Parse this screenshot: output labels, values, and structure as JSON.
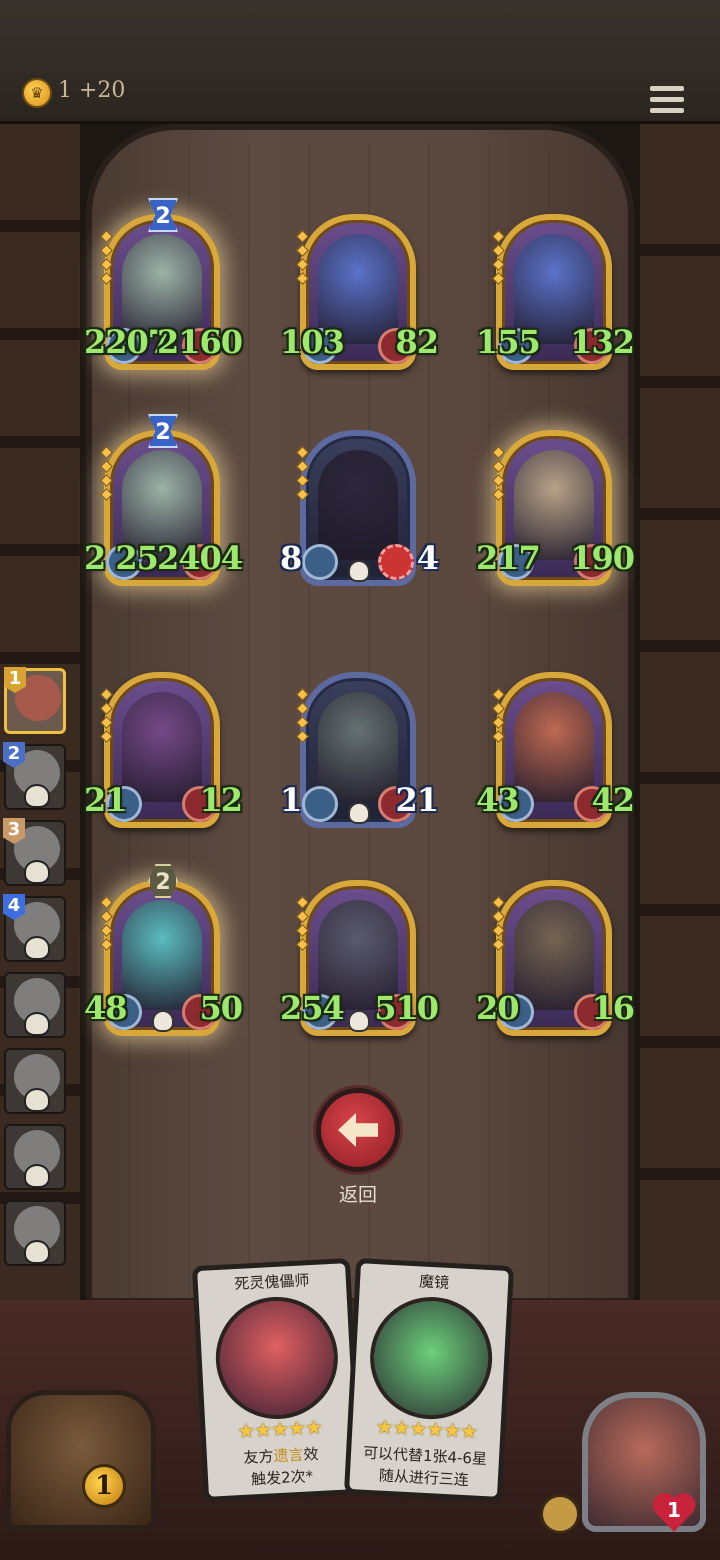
{
  "header": {
    "coin_text": "1 +20",
    "coin_icon": "crown-coin-icon",
    "menu_icon": "hamburger-menu-icon"
  },
  "board": {
    "cards": [
      {
        "name": "minion-slot-1",
        "atk": "2207",
        "hp": "2160",
        "golden": true,
        "tier_badge": "2",
        "portrait_color": "#a8c8b0"
      },
      {
        "name": "minion-slot-2",
        "atk": "103",
        "hp": "82",
        "golden": false,
        "portrait_color": "#5a7bd8"
      },
      {
        "name": "minion-slot-3",
        "atk": "155",
        "hp": "132",
        "golden": false,
        "portrait_color": "#5a7bd8"
      },
      {
        "name": "minion-slot-4",
        "atk": "2",
        "atk_extra": "25",
        "hp": "2404",
        "golden": true,
        "tier_badge": "2",
        "portrait_color": "#a8c8b0"
      },
      {
        "name": "minion-slot-5",
        "atk": "8",
        "hp": "4",
        "golden": false,
        "grey": true,
        "portrait_color": "#2c2438"
      },
      {
        "name": "minion-slot-6",
        "atk": "217",
        "hp": "190",
        "golden": true,
        "portrait_color": "#c8b48a"
      },
      {
        "name": "minion-slot-7",
        "atk": "21",
        "hp": "12",
        "golden": false,
        "portrait_color": "#7a4a8a"
      },
      {
        "name": "minion-slot-8",
        "atk": "1",
        "hp": "21",
        "golden": false,
        "grey": true,
        "portrait_color": "#6f7c78"
      },
      {
        "name": "minion-slot-9",
        "atk": "43",
        "hp": "42",
        "golden": false,
        "portrait_color": "#d0704a"
      },
      {
        "name": "minion-slot-10",
        "atk": "48",
        "hp": "50",
        "golden": true,
        "tier_badge": "2",
        "portrait_color": "#5ad2cc"
      },
      {
        "name": "minion-slot-11",
        "atk": "254",
        "hp": "510",
        "golden": false,
        "portrait_color": "#5a5f6a"
      },
      {
        "name": "minion-slot-12",
        "atk": "20",
        "hp": "16",
        "golden": false,
        "portrait_color": "#7a6a4a"
      }
    ]
  },
  "rankings": [
    {
      "rank": "1",
      "color": "#d9a331"
    },
    {
      "rank": "2",
      "color": "#4a6fc4"
    },
    {
      "rank": "3",
      "color": "#c79a68"
    },
    {
      "rank": "4",
      "color": "#3d6fe0"
    },
    {
      "rank": ""
    },
    {
      "rank": ""
    },
    {
      "rank": ""
    },
    {
      "rank": ""
    }
  ],
  "back_button": {
    "label": "返回"
  },
  "hand": [
    {
      "title": "死灵傀儡师",
      "stars": "★★★★★",
      "desc_pre": "友方",
      "desc_hl": "遗言",
      "desc_post": "效",
      "desc_line2": "触发2次*"
    },
    {
      "title": "魔镜",
      "stars": "★★★★★★",
      "desc_line1": "可以代替1张4-6星",
      "desc_line2": "随从进行三连"
    }
  ],
  "player": {
    "gold": "1",
    "health": "1"
  }
}
